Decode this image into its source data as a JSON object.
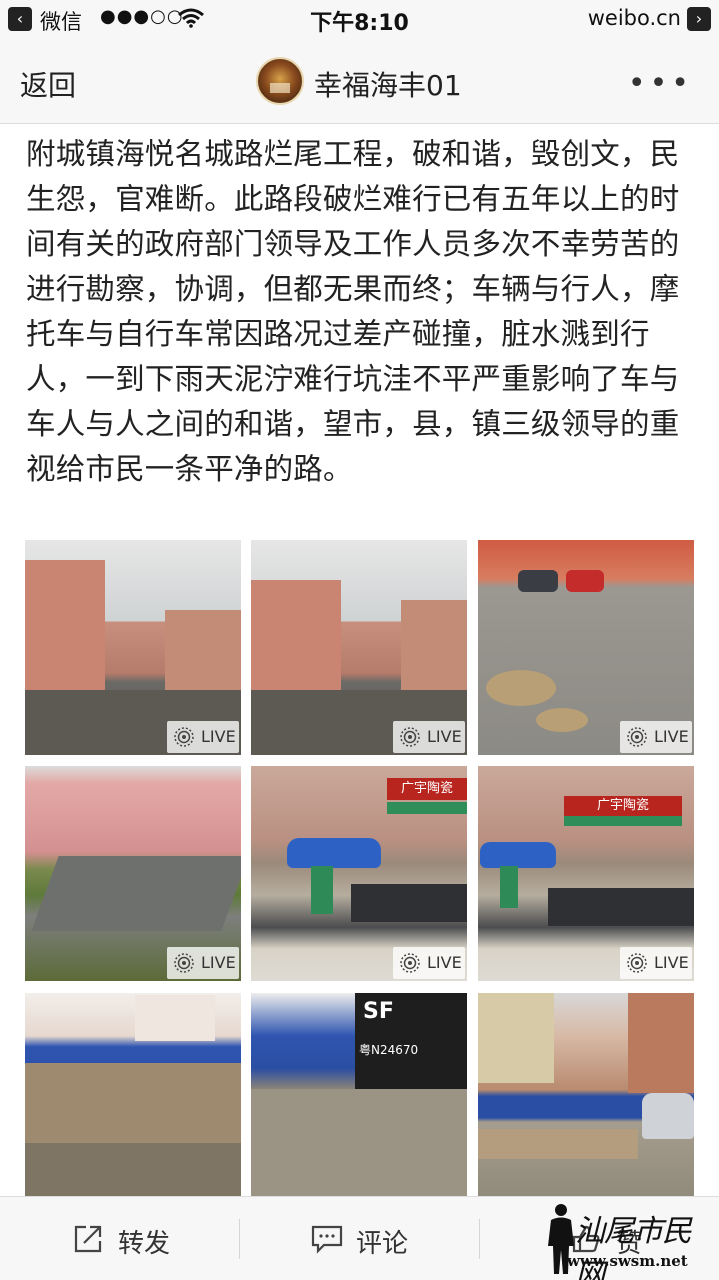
{
  "status_bar": {
    "back_app": "微信",
    "signal": "●●●○○",
    "time": "下午8:10",
    "site": "weibo.cn"
  },
  "nav": {
    "back_label": "返回",
    "user_name": "幸福海丰01",
    "more_label": "•••"
  },
  "post": {
    "text": "附城镇海悦名城路烂尾工程，破和谐，毁创文，民生怨，官难断。此路段破烂难行已有五年以上的时间有关的政府部门领导及工作人员多次不幸劳苦的进行勘察，协调，但都无果而终；车辆与行人，摩托车与自行车常因路况过差产碰撞，脏水溅到行人，一到下雨天泥泞难行坑洼不平严重影响了车与车人与人之间的和谐，望市，县，镇三级领导的重视给市民一条平净的路。"
  },
  "photos": {
    "live_label": "LIVE",
    "p5_sign": "广宇陶瓷",
    "p6_sign": "广宇陶瓷",
    "p8_truck": "SF",
    "p8_plate": "粤N24670"
  },
  "actions": {
    "repost": "转发",
    "comment": "评论",
    "like": "赞"
  },
  "watermark": {
    "title": "汕尾市民网",
    "url": "www.swsm.net"
  }
}
